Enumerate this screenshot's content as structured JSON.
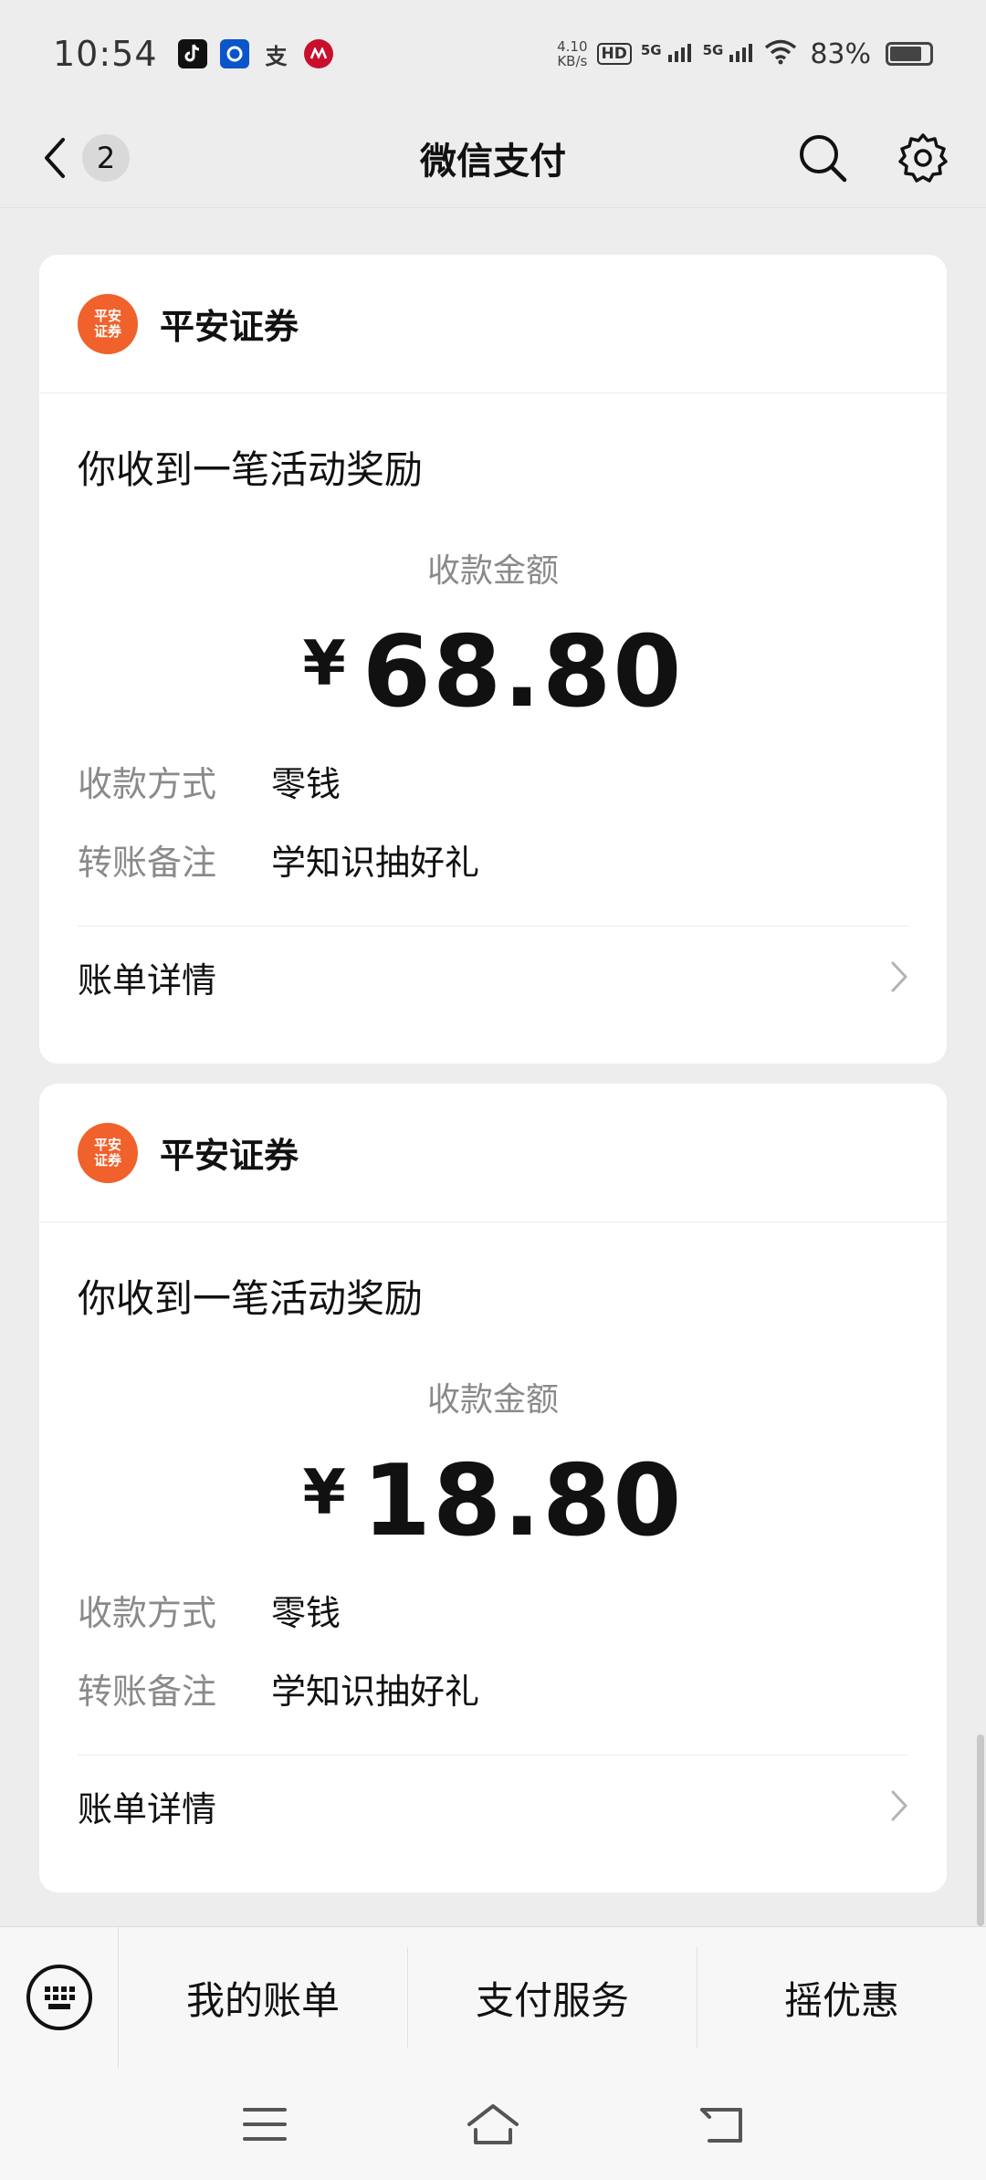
{
  "status_bar": {
    "time": "10:54",
    "net_speed_value": "4.10",
    "net_speed_unit": "KB/s",
    "hd_label": "HD",
    "sig1_label": "5G",
    "sig2_label": "5G",
    "battery_pct": "83%",
    "battery_level": 0.83,
    "alipay_glyph": "支"
  },
  "nav": {
    "title": "微信支付",
    "back_count": "2"
  },
  "cards": [
    {
      "merchant": "平安证券",
      "logo_line1": "平安",
      "logo_line2": "证券",
      "title": "你收到一笔活动奖励",
      "amount_label": "收款金额",
      "currency": "¥",
      "amount": "68.80",
      "method_label": "收款方式",
      "method_value": "零钱",
      "note_label": "转账备注",
      "note_value": "学知识抽好礼",
      "detail_label": "账单详情"
    },
    {
      "merchant": "平安证券",
      "logo_line1": "平安",
      "logo_line2": "证券",
      "title": "你收到一笔活动奖励",
      "amount_label": "收款金额",
      "currency": "¥",
      "amount": "18.80",
      "method_label": "收款方式",
      "method_value": "零钱",
      "note_label": "转账备注",
      "note_value": "学知识抽好礼",
      "detail_label": "账单详情"
    }
  ],
  "bottom_menu": {
    "items": [
      "我的账单",
      "支付服务",
      "摇优惠"
    ]
  },
  "colors": {
    "brand_orange": "#f0612b",
    "background": "#ededed"
  },
  "icons": {
    "back": "chevron-left-icon",
    "search": "search-icon",
    "settings": "gear-icon",
    "detail": "chevron-right-icon",
    "keyboard": "keyboard-icon"
  }
}
